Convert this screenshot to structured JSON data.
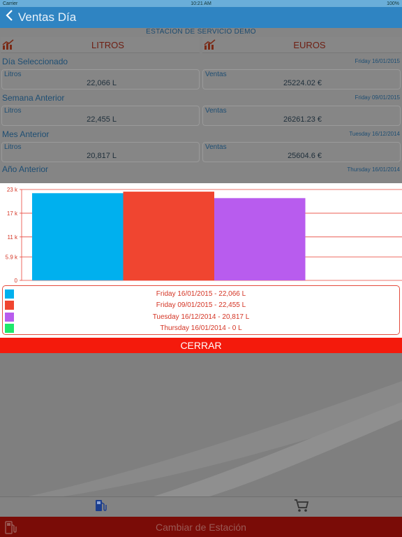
{
  "status": {
    "carrier": "Carrier",
    "time": "10:21 AM",
    "battery": "100%"
  },
  "nav": {
    "back_icon": "chevron-left-icon",
    "title": "Ventas Día"
  },
  "station": "ESTACION DE SERVICIO DEMO",
  "tabs": [
    {
      "label": "LITROS",
      "icon": "chart-up-icon"
    },
    {
      "label": "EUROS",
      "icon": "chart-up-icon"
    }
  ],
  "sections": [
    {
      "name": "Día Seleccionado",
      "date": "Friday 16/01/2015",
      "litros_label": "Litros",
      "litros": "22,066 L",
      "ventas_label": "Ventas",
      "ventas": "25224.02 €"
    },
    {
      "name": "Semana Anterior",
      "date": "Friday 09/01/2015",
      "litros_label": "Litros",
      "litros": "22,455 L",
      "ventas_label": "Ventas",
      "ventas": "26261.23 €"
    },
    {
      "name": "Mes Anterior",
      "date": "Tuesday 16/12/2014",
      "litros_label": "Litros",
      "litros": "20,817 L",
      "ventas_label": "Ventas",
      "ventas": "25604.6 €"
    },
    {
      "name": "Año Anterior",
      "date": "Thursday 16/01/2014"
    }
  ],
  "chart_data": {
    "type": "bar",
    "categories": [
      "Friday 16/01/2015",
      "Friday 09/01/2015",
      "Tuesday 16/12/2014",
      "Thursday 16/01/2014"
    ],
    "values": [
      22066,
      22455,
      20817,
      0
    ],
    "colors": [
      "#00b0ee",
      "#f04530",
      "#b85cee",
      "#1ee86c"
    ],
    "yticks": [
      {
        "value": 0,
        "label": "0"
      },
      {
        "value": 5900,
        "label": "5.9 k"
      },
      {
        "value": 11000,
        "label": "11 k"
      },
      {
        "value": 17000,
        "label": "17 k"
      },
      {
        "value": 23000,
        "label": "23 k"
      }
    ],
    "ylim": [
      0,
      23000
    ],
    "grid": true,
    "legend_position": "bottom"
  },
  "legend": [
    {
      "text": "Friday 16/01/2015 - 22,066 L",
      "color": "#00b0ee"
    },
    {
      "text": "Friday 09/01/2015 - 22,455 L",
      "color": "#f04530"
    },
    {
      "text": "Tuesday 16/12/2014 - 20,817 L",
      "color": "#b85cee"
    },
    {
      "text": "Thursday 16/01/2014 - 0 L",
      "color": "#1ee86c"
    }
  ],
  "close_label": "CERRAR",
  "tabbar": [
    {
      "icon": "fuel-pump-icon",
      "color": "#1c3e8e"
    },
    {
      "icon": "shopping-cart-icon",
      "color": "#333333"
    }
  ],
  "bottom": {
    "icon": "fuel-station-icon",
    "label": "Cambiar de Estación"
  }
}
